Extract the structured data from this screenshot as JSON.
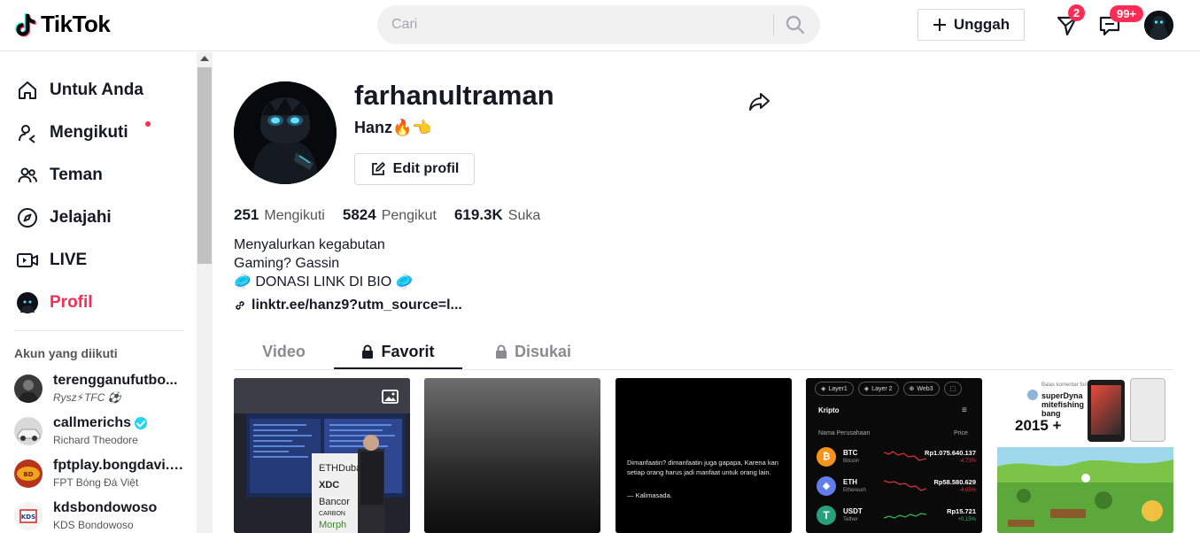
{
  "header": {
    "logo": "TikTok",
    "search_placeholder": "Cari",
    "upload_label": "Unggah",
    "inbox_badge": "2",
    "messages_badge": "99+"
  },
  "sidebar": {
    "nav": [
      {
        "label": "Untuk Anda",
        "icon": "home-icon"
      },
      {
        "label": "Mengikuti",
        "icon": "following-icon"
      },
      {
        "label": "Teman",
        "icon": "friends-icon"
      },
      {
        "label": "Jelajahi",
        "icon": "compass-icon"
      },
      {
        "label": "LIVE",
        "icon": "live-icon"
      },
      {
        "label": "Profil",
        "icon": "avatar"
      }
    ],
    "following_title": "Akun yang diikuti",
    "accounts": [
      {
        "username": "terengganufutbo...",
        "display": "Rysz⚡TFC ⚽"
      },
      {
        "username": "callmerichs",
        "display": "Richard Theodore",
        "verified": true
      },
      {
        "username": "fptplay.bongdavi...",
        "display": "FPT Bóng Đá Việt",
        "verified": true
      },
      {
        "username": "kdsbondowoso",
        "display": "KDS Bondowoso"
      }
    ]
  },
  "profile": {
    "username": "farhanultraman",
    "nickname": "Hanz🔥👈",
    "edit_label": "Edit profil",
    "stats": {
      "following_count": "251",
      "following_label": "Mengikuti",
      "followers_count": "5824",
      "followers_label": "Pengikut",
      "likes_count": "619.3K",
      "likes_label": "Suka"
    },
    "bio": [
      "Menyalurkan kegabutan",
      "Gaming? Gassin",
      "🥏 DONASI LINK DI BIO 🥏"
    ],
    "link": "linktr.ee/hanz9?utm_source=l..."
  },
  "tabs": [
    {
      "label": "Video",
      "locked": false
    },
    {
      "label": "Favorit",
      "locked": true,
      "active": true
    },
    {
      "label": "Disukai",
      "locked": true
    }
  ],
  "tiles": {
    "t1_text": [
      "ETHDubai",
      "XDC",
      "Bancor",
      "CARBON",
      "Morph"
    ],
    "t3_quote": "Dimanfaatin? dimanfaatin juga gapapa, Karena kan setiap orang harus jadi manfaat untuk orang lain.",
    "t3_author": "— Kalimasada.",
    "t4": {
      "tabs": [
        "Layer1",
        "Layer 2",
        "Web3"
      ],
      "title": "Kripto",
      "col1": "Nama Perusahaan",
      "col2": "Price",
      "coins": [
        {
          "sym": "BTC",
          "name": "Bitcoin",
          "price": "Rp1.075.640.137",
          "change": "-4,73%",
          "color": "#f7931a",
          "trend": "down"
        },
        {
          "sym": "ETH",
          "name": "Ethereum",
          "price": "Rp58.580.629",
          "change": "-4,65%",
          "color": "#627eea",
          "trend": "down"
        },
        {
          "sym": "USDT",
          "name": "Tether",
          "price": "Rp15.721",
          "change": "+0,15%",
          "color": "#26a17b",
          "trend": "up"
        }
      ]
    },
    "t5": {
      "caption": "Balas komentar football_999",
      "text1": "superDyna",
      "text2": "mitefishing",
      "text3": "bang",
      "text4": "2015 +"
    }
  }
}
